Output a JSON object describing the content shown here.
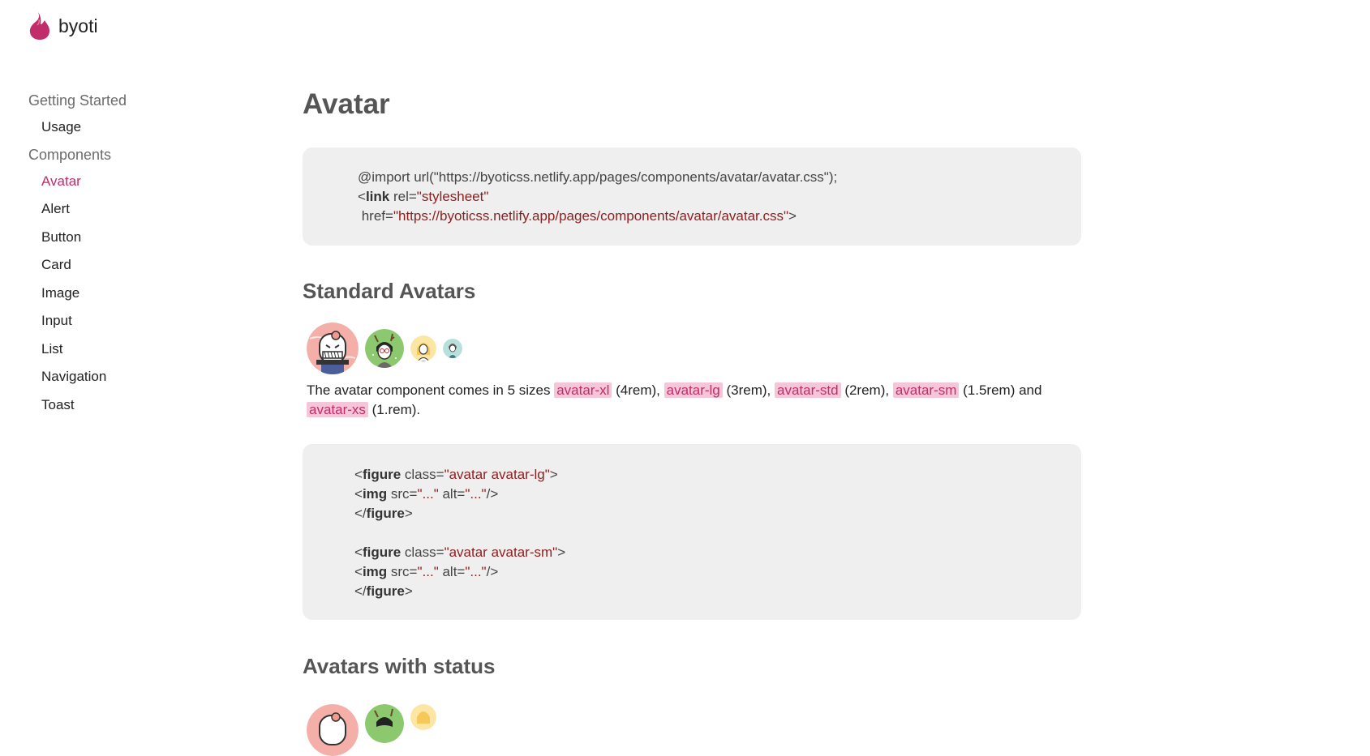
{
  "brand": {
    "name": "byoti",
    "accent": "#c12d6b"
  },
  "sidebar": {
    "sections": [
      {
        "heading": "Getting Started",
        "items": [
          "Usage"
        ]
      },
      {
        "heading": "Components",
        "items": [
          "Avatar",
          "Alert",
          "Button",
          "Card",
          "Image",
          "Input",
          "List",
          "Navigation",
          "Toast"
        ]
      }
    ],
    "active_item": "Avatar"
  },
  "main": {
    "title": "Avatar",
    "import_block": {
      "line1": "@import url(\"https://byoticss.netlify.app/pages/components/avatar/avatar.css\");",
      "lt": "<",
      "link_tag": "link",
      "rel_attr": " rel=",
      "rel_value": "\"stylesheet\"",
      "href_attr": " href=",
      "href_value": "\"https://byoticss.netlify.app/pages/components/avatar/avatar.css\"",
      "gt": ">"
    },
    "standard_heading": "Standard Avatars",
    "description": {
      "prefix": "The avatar component comes in 5 sizes ",
      "xl": "avatar-xl",
      "xl_size": " (4rem), ",
      "lg": "avatar-lg",
      "lg_size": " (3rem), ",
      "std": "avatar-std",
      "std_size": " (2rem), ",
      "sm": "avatar-sm",
      "sm_size": " (1.5rem) and ",
      "xs": "avatar-xs",
      "xs_size": " (1.rem)."
    },
    "code_block": {
      "figure_tag": "figure",
      "img_tag": "img",
      "class_attr": " class=",
      "src_attr": " src=",
      "alt_attr": " alt=",
      "lg_class": "\"avatar avatar-lg\"",
      "sm_class": "\"avatar avatar-sm\"",
      "ellipsis": "\"...\"",
      "open": "<",
      "close_open": "</",
      "gt": ">",
      "self_close": "/>"
    },
    "status_heading": "Avatars with status"
  }
}
